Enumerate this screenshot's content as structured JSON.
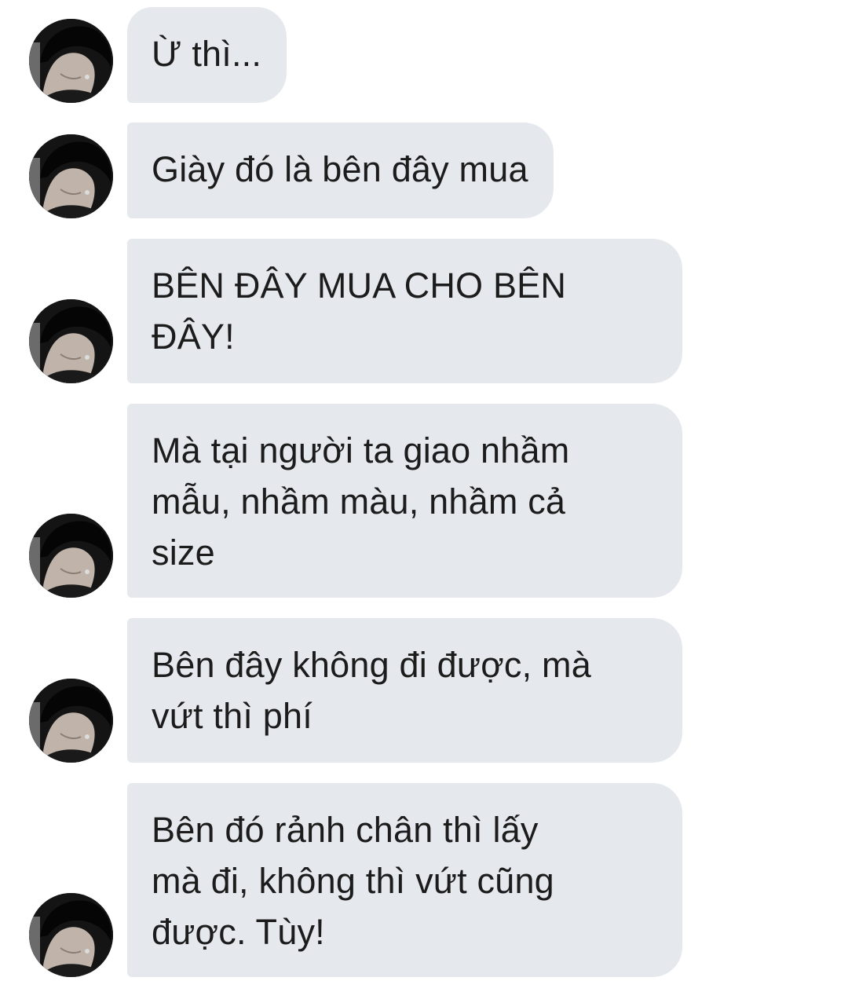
{
  "conversation": {
    "avatar_icon": "user-avatar-photo",
    "bubble_color": "#e5e9ee",
    "text_color": "#1c1c1c",
    "messages": [
      {
        "lines": [
          "Ừ thì..."
        ]
      },
      {
        "lines": [
          "Giày đó là bên đây mua"
        ]
      },
      {
        "lines": [
          "BÊN ĐÂY MUA CHO BÊN",
          "ĐÂY!"
        ]
      },
      {
        "lines": [
          "Mà tại người ta giao nhầm",
          "mẫu, nhầm màu, nhầm cả",
          "size"
        ]
      },
      {
        "lines": [
          "Bên đây không đi được, mà",
          "vứt thì phí"
        ]
      },
      {
        "lines": [
          "Bên đó rảnh chân thì lấy",
          "mà đi, không thì vứt cũng",
          "được. Tùy!"
        ]
      }
    ]
  }
}
